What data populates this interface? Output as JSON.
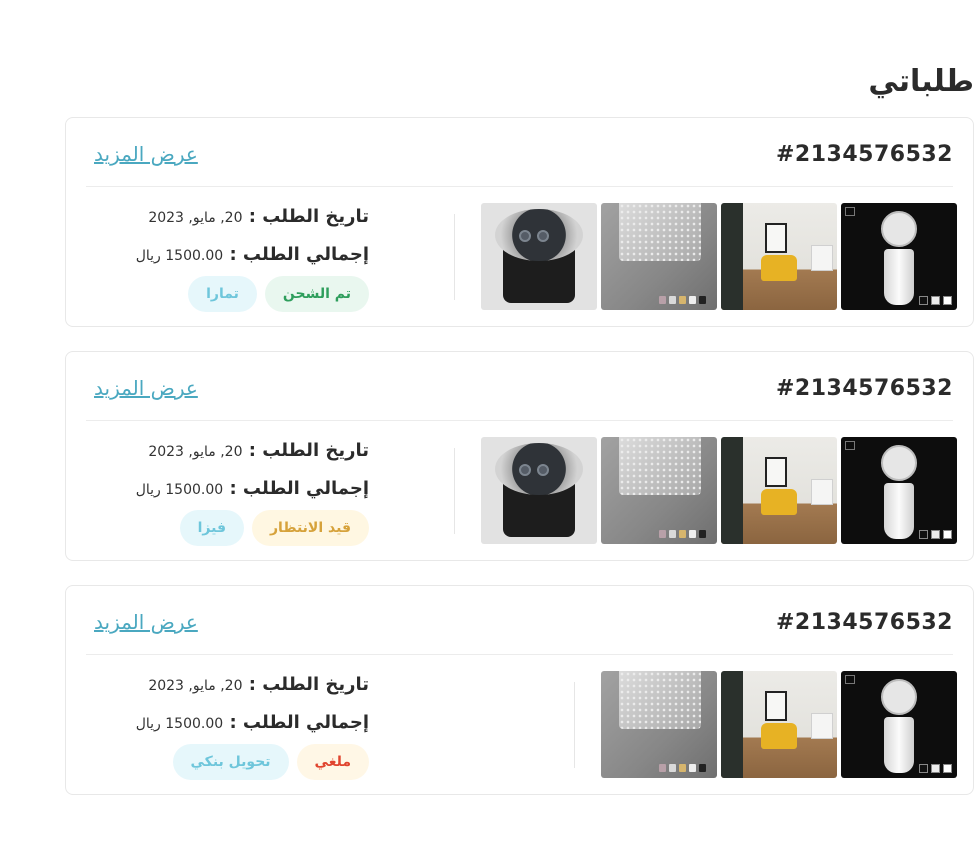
{
  "page": {
    "title": "طلباتي"
  },
  "orders": [
    {
      "number": "#2134576532",
      "more_label": "عرض المزيد",
      "date_label": "تاريخ الطلب :",
      "date_value": "20, مايو, 2023",
      "total_label": "إجمالي الطلب :",
      "total_value": "1500.00 ريال",
      "status": "تم الشحن",
      "status_color": "#2e9e5c",
      "payment": "تمارا",
      "products": [
        "pedestal-basin",
        "living-room-chair",
        "rain-shower-head",
        "inground-light"
      ]
    },
    {
      "number": "#2134576532",
      "more_label": "عرض المزيد",
      "date_label": "تاريخ الطلب :",
      "date_value": "20, مايو, 2023",
      "total_label": "إجمالي الطلب :",
      "total_value": "1500.00 ريال",
      "status": "قيد الانتظار",
      "status_color": "#d6a23b",
      "payment": "فيزا",
      "products": [
        "pedestal-basin",
        "living-room-chair",
        "rain-shower-head",
        "inground-light"
      ]
    },
    {
      "number": "#2134576532",
      "more_label": "عرض المزيد",
      "date_label": "تاريخ الطلب :",
      "date_value": "20, مايو, 2023",
      "total_label": "إجمالي الطلب :",
      "total_value": "1500.00 ريال",
      "status": "ملغي",
      "status_color": "#e0442e",
      "payment": "تحويل بنكي",
      "products": [
        "pedestal-basin",
        "living-room-chair",
        "rain-shower-head"
      ]
    }
  ],
  "colors": {
    "link": "#4aa8c0",
    "border": "#e8e8e8",
    "text": "#2b2b2b"
  }
}
